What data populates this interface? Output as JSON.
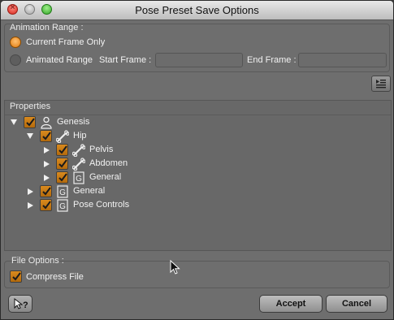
{
  "window": {
    "title": "Pose Preset Save Options"
  },
  "animation_range": {
    "header": "Animation Range :",
    "current_frame_label": "Current Frame Only",
    "animated_range_label": "Animated Range",
    "start_frame_label": "Start Frame :",
    "start_frame_value": "",
    "end_frame_label": "End Frame :",
    "end_frame_value": "",
    "selected": "current_frame"
  },
  "properties": {
    "header": "Properties",
    "rows": [
      {
        "label": "Genesis",
        "icon": "figure-icon",
        "expanded": true,
        "checked": true,
        "depth": 0
      },
      {
        "label": "Hip",
        "icon": "bone-icon",
        "expanded": true,
        "checked": true,
        "depth": 1
      },
      {
        "label": "Pelvis",
        "icon": "bone-icon",
        "expanded": false,
        "checked": true,
        "depth": 2
      },
      {
        "label": "Abdomen",
        "icon": "bone-icon",
        "expanded": false,
        "checked": true,
        "depth": 2
      },
      {
        "label": "General",
        "icon": "general-group-icon",
        "expanded": false,
        "checked": true,
        "depth": 2
      },
      {
        "label": "General",
        "icon": "general-group-icon",
        "expanded": false,
        "checked": true,
        "depth": 1
      },
      {
        "label": "Pose Controls",
        "icon": "general-group-icon",
        "expanded": false,
        "checked": true,
        "depth": 1
      }
    ]
  },
  "file_options": {
    "header": "File Options :",
    "compress_label": "Compress File",
    "compress_checked": true
  },
  "buttons": {
    "help": "?",
    "accept": "Accept",
    "cancel": "Cancel"
  },
  "colors": {
    "accent": "#e07b10",
    "panel": "#6e6e6e"
  }
}
